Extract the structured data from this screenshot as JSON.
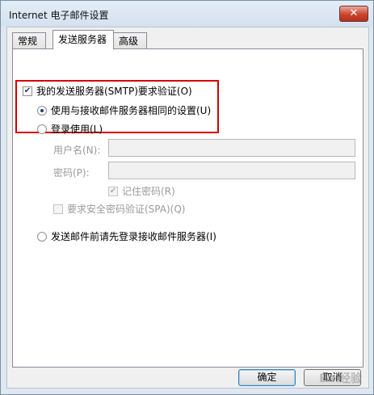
{
  "window": {
    "title": "Internet 电子邮件设置",
    "close_symbol": "✕"
  },
  "tabs": [
    {
      "label": "常规"
    },
    {
      "label": "发送服务器"
    },
    {
      "label": "高级"
    }
  ],
  "outgoing": {
    "require_auth_label": "我的发送服务器(SMTP)要求验证(O)",
    "require_auth_checked": true,
    "same_settings_label": "使用与接收邮件服务器相同的设置(U)",
    "logon_using_label": "登录使用(L)",
    "username_label": "用户名(N):",
    "username_value": "",
    "password_label": "密码(P):",
    "password_value": "",
    "remember_password_label": "记住密码(R)",
    "remember_password_checked": true,
    "spa_label": "要求安全密码验证(SPA)(Q)",
    "logon_before_label": "发送邮件前请先登录接收邮件服务器(I)"
  },
  "buttons": {
    "ok": "确定",
    "cancel": "取消"
  },
  "watermark": "Bai经验"
}
